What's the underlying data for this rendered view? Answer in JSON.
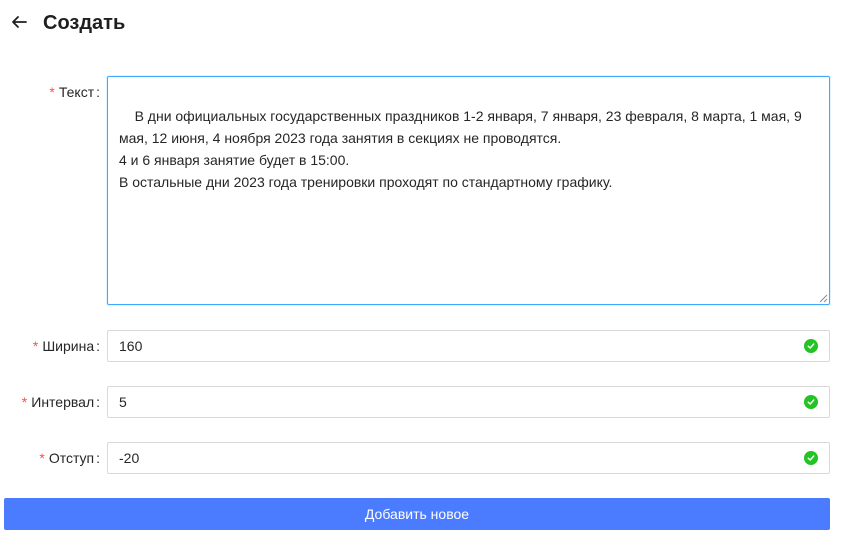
{
  "header": {
    "title": "Создать",
    "back_icon": "arrow-left-icon"
  },
  "form": {
    "required_mark": "*",
    "colon": ":",
    "text": {
      "label": "Текст",
      "value": "В дни официальных государственных праздников 1-2 января, 7 января, 23 февраля, 8 марта, 1 мая, 9 мая, 12 июня, 4 ноября 2023 года занятия в секциях не проводятся.\n4 и 6 января занятие будет в 15:00.\nВ остальные дни 2023 года тренировки проходят по стандартному графику."
    },
    "width": {
      "label": "Ширина",
      "value": "160"
    },
    "interval": {
      "label": "Интервал",
      "value": "5"
    },
    "offset": {
      "label": "Отступ",
      "value": "-20"
    }
  },
  "actions": {
    "submit_label": "Добавить новое"
  },
  "colors": {
    "accent": "#4b7bff",
    "required": "#ff4d4f",
    "valid": "#22c322",
    "focus_border": "#40a9ff"
  }
}
